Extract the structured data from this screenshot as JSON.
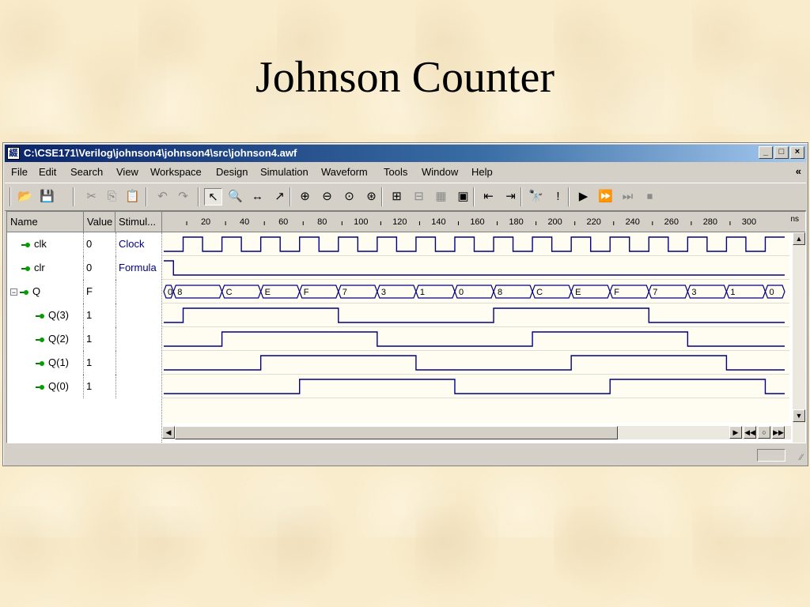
{
  "slide": {
    "title": "Johnson Counter"
  },
  "window": {
    "title": "C:\\CSE171\\Verilog\\johnson4\\johnson4\\src\\johnson4.awf",
    "controls": [
      "_",
      "□",
      "×"
    ]
  },
  "menu": {
    "items": [
      "File",
      "Edit",
      "Search",
      "View",
      "Workspace",
      "Design",
      "Simulation",
      "Waveform",
      "Tools",
      "Window",
      "Help"
    ],
    "overflow": "«"
  },
  "toolbar": {
    "buttons": [
      {
        "name": "open-icon",
        "glyph": "📂"
      },
      {
        "name": "save-icon",
        "glyph": "💾"
      },
      {
        "name": "cut-icon",
        "glyph": "✂"
      },
      {
        "name": "copy-icon",
        "glyph": "⎘"
      },
      {
        "name": "paste-icon",
        "glyph": "📋"
      },
      {
        "name": "undo-icon",
        "glyph": "↶"
      },
      {
        "name": "redo-icon",
        "glyph": "↷"
      },
      {
        "name": "select-pointer-icon",
        "glyph": "↖"
      },
      {
        "name": "zoom-icon",
        "glyph": "🔍"
      },
      {
        "name": "measure-icon",
        "glyph": "↔"
      },
      {
        "name": "select-waveform-icon",
        "glyph": "↗"
      },
      {
        "name": "zoom-in-icon",
        "glyph": "⊕"
      },
      {
        "name": "zoom-out-icon",
        "glyph": "⊖"
      },
      {
        "name": "zoom-fit-icon",
        "glyph": "⊙"
      },
      {
        "name": "zoom-range-icon",
        "glyph": "⊛"
      },
      {
        "name": "add-signal-icon",
        "glyph": "⊞"
      },
      {
        "name": "remove-signal-icon",
        "glyph": "⊟"
      },
      {
        "name": "group-icon",
        "glyph": "▦"
      },
      {
        "name": "compare-icon",
        "glyph": "▣"
      },
      {
        "name": "previous-edge-icon",
        "glyph": "⇤"
      },
      {
        "name": "next-edge-icon",
        "glyph": "⇥"
      },
      {
        "name": "find-icon",
        "glyph": "🔭"
      },
      {
        "name": "find-next-icon",
        "glyph": "!"
      },
      {
        "name": "run-icon",
        "glyph": "▶"
      },
      {
        "name": "run-for-icon",
        "glyph": "⏩"
      },
      {
        "name": "step-icon",
        "glyph": "⏭"
      },
      {
        "name": "stop-icon",
        "glyph": "⏹"
      }
    ]
  },
  "columns": {
    "name": "Name",
    "value": "Value",
    "stimulus": "Stimul..."
  },
  "timeline": {
    "unit": "ns",
    "ticks": [
      "20",
      "40",
      "60",
      "80",
      "100",
      "120",
      "140",
      "160",
      "180",
      "200",
      "220",
      "240",
      "260",
      "280",
      "300"
    ]
  },
  "signals": [
    {
      "name": "clk",
      "value": "0",
      "stimulus": "Clock",
      "kind": "clock"
    },
    {
      "name": "clr",
      "value": "0",
      "stimulus": "Formula",
      "kind": "bit"
    },
    {
      "name": "Q",
      "value": "F",
      "stimulus": "",
      "kind": "bus",
      "expandable": "−"
    },
    {
      "name": "Q(3)",
      "value": "1",
      "stimulus": "",
      "kind": "bit"
    },
    {
      "name": "Q(2)",
      "value": "1",
      "stimulus": "",
      "kind": "bit"
    },
    {
      "name": "Q(1)",
      "value": "1",
      "stimulus": "",
      "kind": "bit"
    },
    {
      "name": "Q(0)",
      "value": "1",
      "stimulus": "",
      "kind": "bit"
    }
  ],
  "waveforms": {
    "time_range_ns": [
      0,
      320
    ],
    "clock_period_ns": 20,
    "clock_first_rise_ns": 10,
    "clr_high_until_ns": 5,
    "bus_segments": [
      {
        "value": "0",
        "from": 0,
        "to": 5
      },
      {
        "value": "8",
        "from": 5,
        "to": 30
      },
      {
        "value": "C",
        "from": 30,
        "to": 50
      },
      {
        "value": "E",
        "from": 50,
        "to": 70
      },
      {
        "value": "F",
        "from": 70,
        "to": 90
      },
      {
        "value": "7",
        "from": 90,
        "to": 110
      },
      {
        "value": "3",
        "from": 110,
        "to": 130
      },
      {
        "value": "1",
        "from": 130,
        "to": 150
      },
      {
        "value": "0",
        "from": 150,
        "to": 170
      },
      {
        "value": "8",
        "from": 170,
        "to": 190
      },
      {
        "value": "C",
        "from": 190,
        "to": 210
      },
      {
        "value": "E",
        "from": 210,
        "to": 230
      },
      {
        "value": "F",
        "from": 230,
        "to": 250
      },
      {
        "value": "7",
        "from": 250,
        "to": 270
      },
      {
        "value": "3",
        "from": 270,
        "to": 290
      },
      {
        "value": "1",
        "from": 290,
        "to": 310
      },
      {
        "value": "0",
        "from": 310,
        "to": 320
      }
    ],
    "bits": {
      "Q(3)": [
        [
          0,
          0
        ],
        [
          10,
          1
        ],
        [
          90,
          0
        ],
        [
          170,
          1
        ],
        [
          250,
          0
        ]
      ],
      "Q(2)": [
        [
          0,
          0
        ],
        [
          30,
          1
        ],
        [
          110,
          0
        ],
        [
          190,
          1
        ],
        [
          270,
          0
        ]
      ],
      "Q(1)": [
        [
          0,
          0
        ],
        [
          50,
          1
        ],
        [
          130,
          0
        ],
        [
          210,
          1
        ],
        [
          290,
          0
        ]
      ],
      "Q(0)": [
        [
          0,
          0
        ],
        [
          70,
          1
        ],
        [
          150,
          0
        ],
        [
          230,
          1
        ],
        [
          310,
          0
        ]
      ]
    }
  },
  "scroll_controls": [
    "▶",
    "◀◀",
    "○",
    "▶▶"
  ],
  "colors": {
    "wave": "#000080",
    "signal_icon": "#00a000",
    "titlebar": "#0a246a"
  }
}
